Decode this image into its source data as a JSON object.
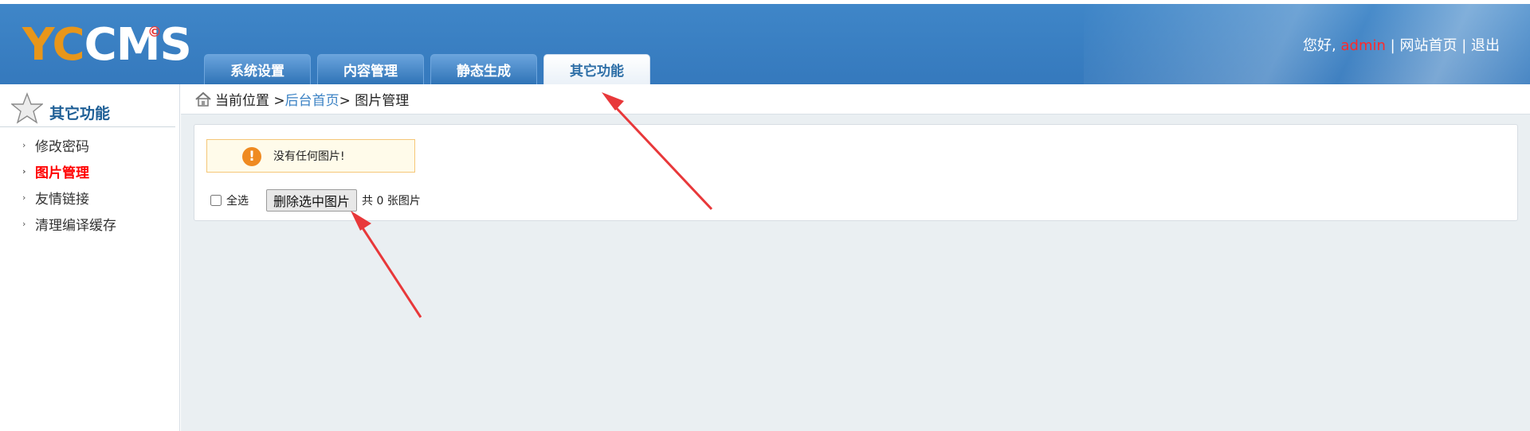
{
  "header": {
    "logo_yc": "YC",
    "logo_cms": "CMS",
    "logo_mark": "©",
    "greeting": "您好,",
    "username": "admin",
    "separator": "|",
    "home_link": "网站首页",
    "logout_link": "退出"
  },
  "tabs": [
    {
      "label": "系统设置",
      "active": false
    },
    {
      "label": "内容管理",
      "active": false
    },
    {
      "label": "静态生成",
      "active": false
    },
    {
      "label": "其它功能",
      "active": true
    }
  ],
  "sidebar": {
    "title": "其它功能",
    "icon": "star-icon",
    "items": [
      {
        "label": "修改密码",
        "active": false
      },
      {
        "label": "图片管理",
        "active": true
      },
      {
        "label": "友情链接",
        "active": false
      },
      {
        "label": "清理编译缓存",
        "active": false
      }
    ]
  },
  "breadcrumb": {
    "prefix": "当前位置 >",
    "link": "后台首页",
    "current": "> 图片管理"
  },
  "notice": {
    "text": "没有任何图片!",
    "icon": "warning-icon",
    "color": "#ef8a21"
  },
  "controls": {
    "select_all_label": "全选",
    "delete_button": "删除选中图片",
    "count_text": "共 0 张图片"
  },
  "annotation_color": "#e8383a"
}
